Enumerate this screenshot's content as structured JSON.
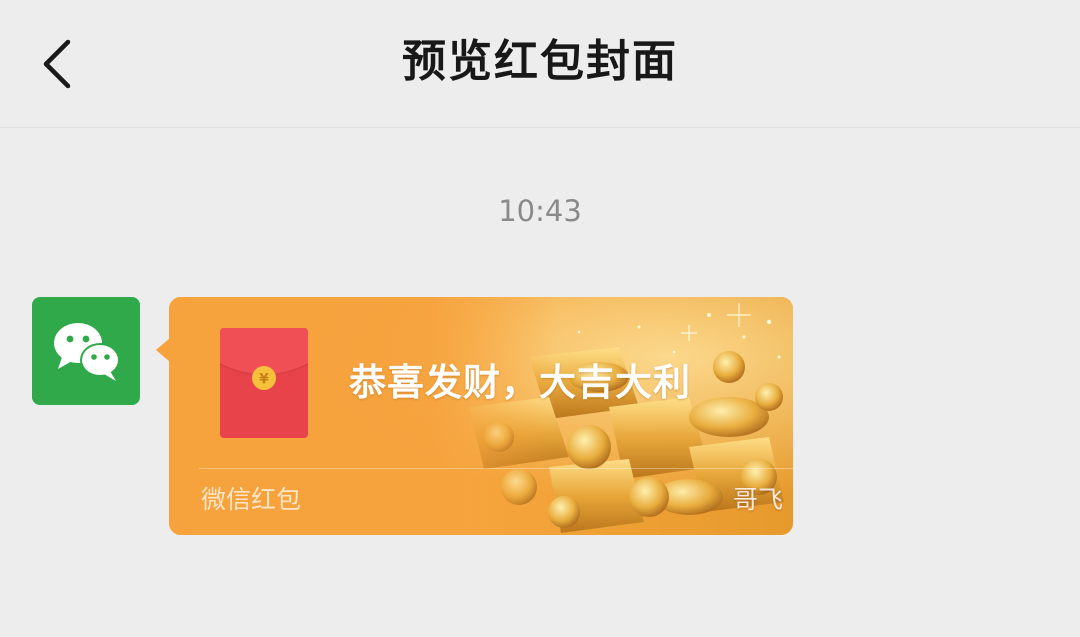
{
  "header": {
    "title": "预览红包封面",
    "back_icon": "chevron-left-icon"
  },
  "chat": {
    "timestamp": "10:43",
    "avatar_icon": "wechat-logo-icon",
    "red_packet": {
      "greeting": "恭喜发财，大吉大利",
      "brand_label": "微信红包",
      "sender_name": "哥飞",
      "packet_icon": "red-envelope-icon",
      "coin_symbol": "¥",
      "cover_background": "gold-ingots-image"
    }
  },
  "colors": {
    "page_background": "#ededed",
    "wechat_green": "#2fa94a",
    "packet_orange": "#f6a23d",
    "envelope_red": "#e8424a",
    "coin_gold": "#f5c13a"
  }
}
